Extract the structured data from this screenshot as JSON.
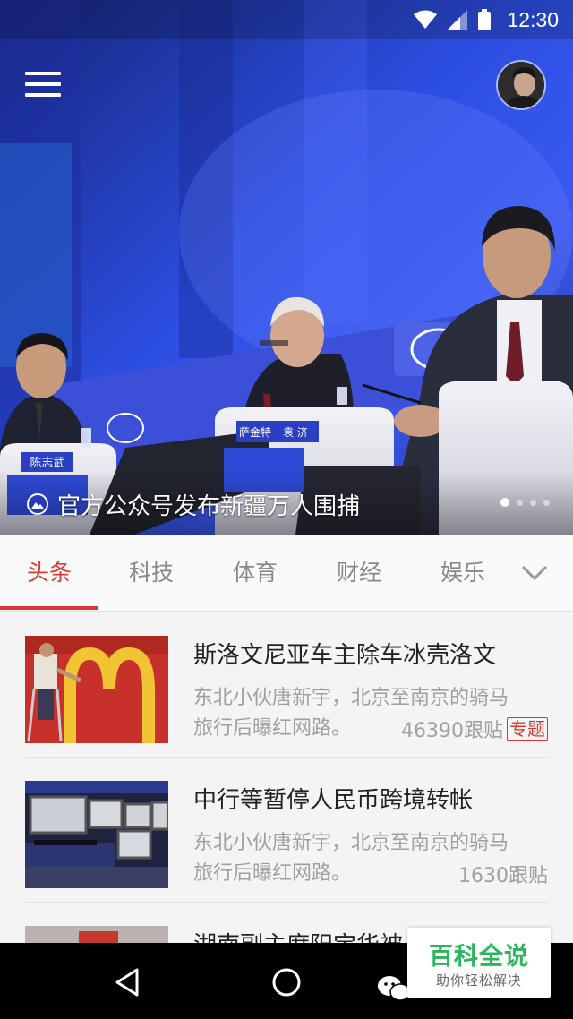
{
  "status_bar": {
    "time": "12:30"
  },
  "header": {
    "menu_icon": "hamburger-icon",
    "avatar_icon": "user-avatar"
  },
  "hero": {
    "caption": "官方公众号发布新疆万人围捕",
    "caption_icon": "image-gallery-icon",
    "slide_count": 4,
    "active_slide": 1,
    "nameplate_left": "陈志武",
    "nameplate_center_a": "萨金特",
    "nameplate_center_b": "袁 济"
  },
  "tabs": {
    "items": [
      "头条",
      "科技",
      "体育",
      "财经",
      "娱乐"
    ],
    "active": "头条",
    "expand_icon": "chevron-down-icon"
  },
  "news": {
    "items": [
      {
        "title": "斯洛文尼亚车主除车冰壳洛文",
        "summary_line1": "东北小伙唐新宇，北京至南京的骑马",
        "summary_line2": "旅行后曝红网路。",
        "replies": "46390跟贴",
        "tag": "专题",
        "thumb": "mcdonalds-sign-photo"
      },
      {
        "title": "中行等暂停人民币跨境转帐",
        "summary_line1": "东北小伙唐新宇，北京至南京的骑马",
        "summary_line2": "旅行后曝红网路。",
        "replies": "1630跟贴",
        "tag": "",
        "thumb": "control-room-photo"
      },
      {
        "title": "湖南副主席阳宝华被",
        "thumb": "building-photo"
      }
    ]
  },
  "nav_bar": {
    "back_icon": "back-triangle-icon",
    "home_icon": "home-circle-icon",
    "recents_icon": "recents-square-icon"
  },
  "watermark": {
    "title": "百科全说",
    "subtitle": "助你轻松解决"
  },
  "colors": {
    "accent": "#d43c33",
    "watermark_green": "#2db55d"
  }
}
